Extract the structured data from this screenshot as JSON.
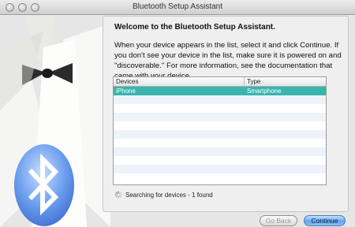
{
  "window": {
    "title": "Bluetooth Setup Assistant"
  },
  "main": {
    "heading": "Welcome to the Bluetooth Setup Assistant.",
    "lines": [
      "When your device appears in the list, select it and click Continue. If",
      "you don't see your device in the list, make sure it is powered on and",
      "\"discoverable.\" For more information, see the documentation that",
      "came with your device."
    ]
  },
  "table": {
    "columns": [
      "Devices",
      "Type"
    ],
    "rows": [
      {
        "device": "iPhone",
        "type": "Smartphone",
        "selected": true
      }
    ]
  },
  "status": {
    "text": "Searching for devices - 1 found"
  },
  "buttons": {
    "back_label": "Go Back",
    "continue_label": "Continue"
  },
  "colors": {
    "selection": "#38b6ae",
    "accent": "#62a6ee"
  },
  "icons": [
    "bluetooth-icon",
    "tuxedo-illustration",
    "spinner-icon"
  ]
}
